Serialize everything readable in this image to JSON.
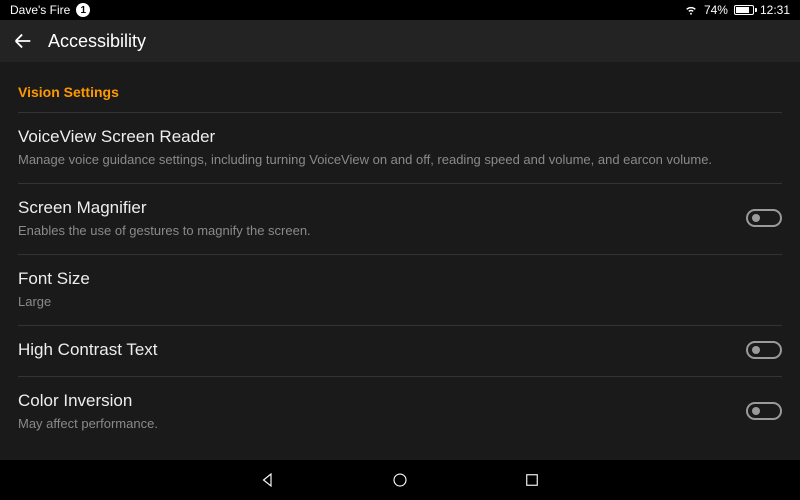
{
  "status": {
    "device_name": "Dave's Fire",
    "notif_count": "1",
    "battery_pct": "74%",
    "time": "12:31"
  },
  "appbar": {
    "title": "Accessibility"
  },
  "section": {
    "header": "Vision Settings"
  },
  "rows": {
    "voiceview": {
      "title": "VoiceView Screen Reader",
      "sub": "Manage voice guidance settings, including turning VoiceView on and off, reading speed and volume, and earcon volume."
    },
    "magnifier": {
      "title": "Screen Magnifier",
      "sub": "Enables the use of gestures to magnify the screen."
    },
    "fontsize": {
      "title": "Font Size",
      "sub": "Large"
    },
    "highcontrast": {
      "title": "High Contrast Text"
    },
    "colorinv": {
      "title": "Color Inversion",
      "sub": "May affect performance."
    }
  }
}
